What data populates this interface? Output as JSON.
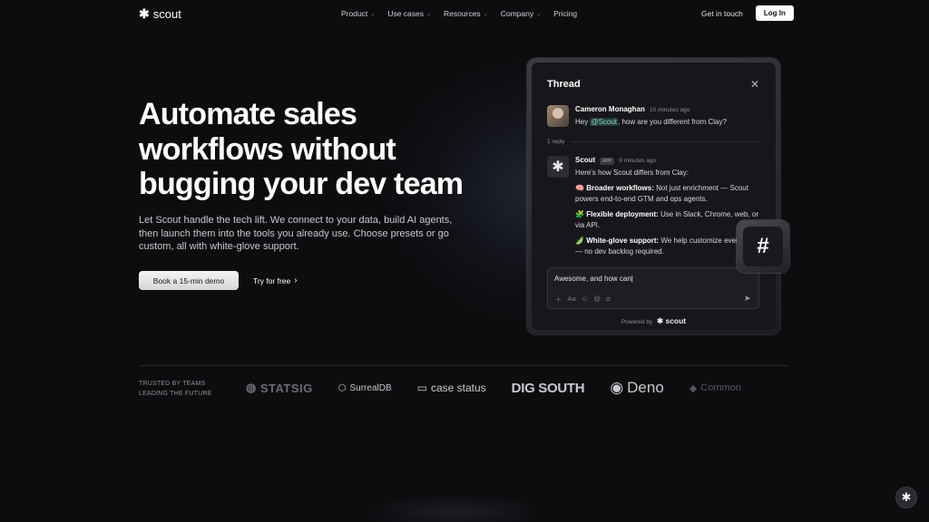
{
  "nav": {
    "logo_star": "✱",
    "logo_text": "scout",
    "links": [
      {
        "label": "Product",
        "has_menu": true
      },
      {
        "label": "Use cases",
        "has_menu": true
      },
      {
        "label": "Resources",
        "has_menu": true
      },
      {
        "label": "Company",
        "has_menu": true
      },
      {
        "label": "Pricing",
        "has_menu": false
      }
    ],
    "get_in_touch": "Get in touch",
    "login": "Log In"
  },
  "hero": {
    "title_line1": "Automate sales",
    "title_line2": "workflows without",
    "title_line3": "bugging your dev team",
    "subtitle": "Let Scout handle the tech lift. We connect to your data, build AI agents, then launch them into the tools you already use. Choose presets or go custom, all with white-glove support.",
    "cta_primary": "Book a 15-min demo",
    "cta_secondary": "Try for free"
  },
  "thread": {
    "title": "Thread",
    "message1": {
      "author": "Cameron Monaghan",
      "time": "10 minutes ago",
      "text_pre": "Hey ",
      "mention": "@Scout",
      "text_post": ", how are you different from Clay?"
    },
    "replies": "1 reply",
    "message2": {
      "author": "Scout",
      "badge": "APP",
      "time": "9 minutes ago",
      "intro": "Here's how Scout differs from Clay:",
      "bullets": [
        {
          "emoji": "🧠",
          "bold": "Broader workflows:",
          "text": " Not just enrichment — Scout powers end-to-end GTM and ops agents."
        },
        {
          "emoji": "🧩",
          "bold": "Flexible deployment:",
          "text": " Use in Slack, Chrome, web, or via API."
        },
        {
          "emoji": "🫛",
          "bold": "White-glove support:",
          "text": " We help customize everything — no dev backlog required."
        }
      ]
    },
    "composer_value": "Awesome, and how can",
    "powered_by": "Powered by",
    "powered_brand": "✱ scout"
  },
  "trusted": {
    "line1": "TRUSTED BY TEAMS",
    "line2": "LEADING THE FUTURE",
    "logos": [
      "STATSIG",
      "SurrealDB",
      "case status",
      "DIG SOUTH",
      "Deno",
      "Common"
    ]
  },
  "icons": {
    "close": "close-icon",
    "chevron": "chevron-down-icon",
    "slack": "slack-icon",
    "send": "send-icon"
  }
}
